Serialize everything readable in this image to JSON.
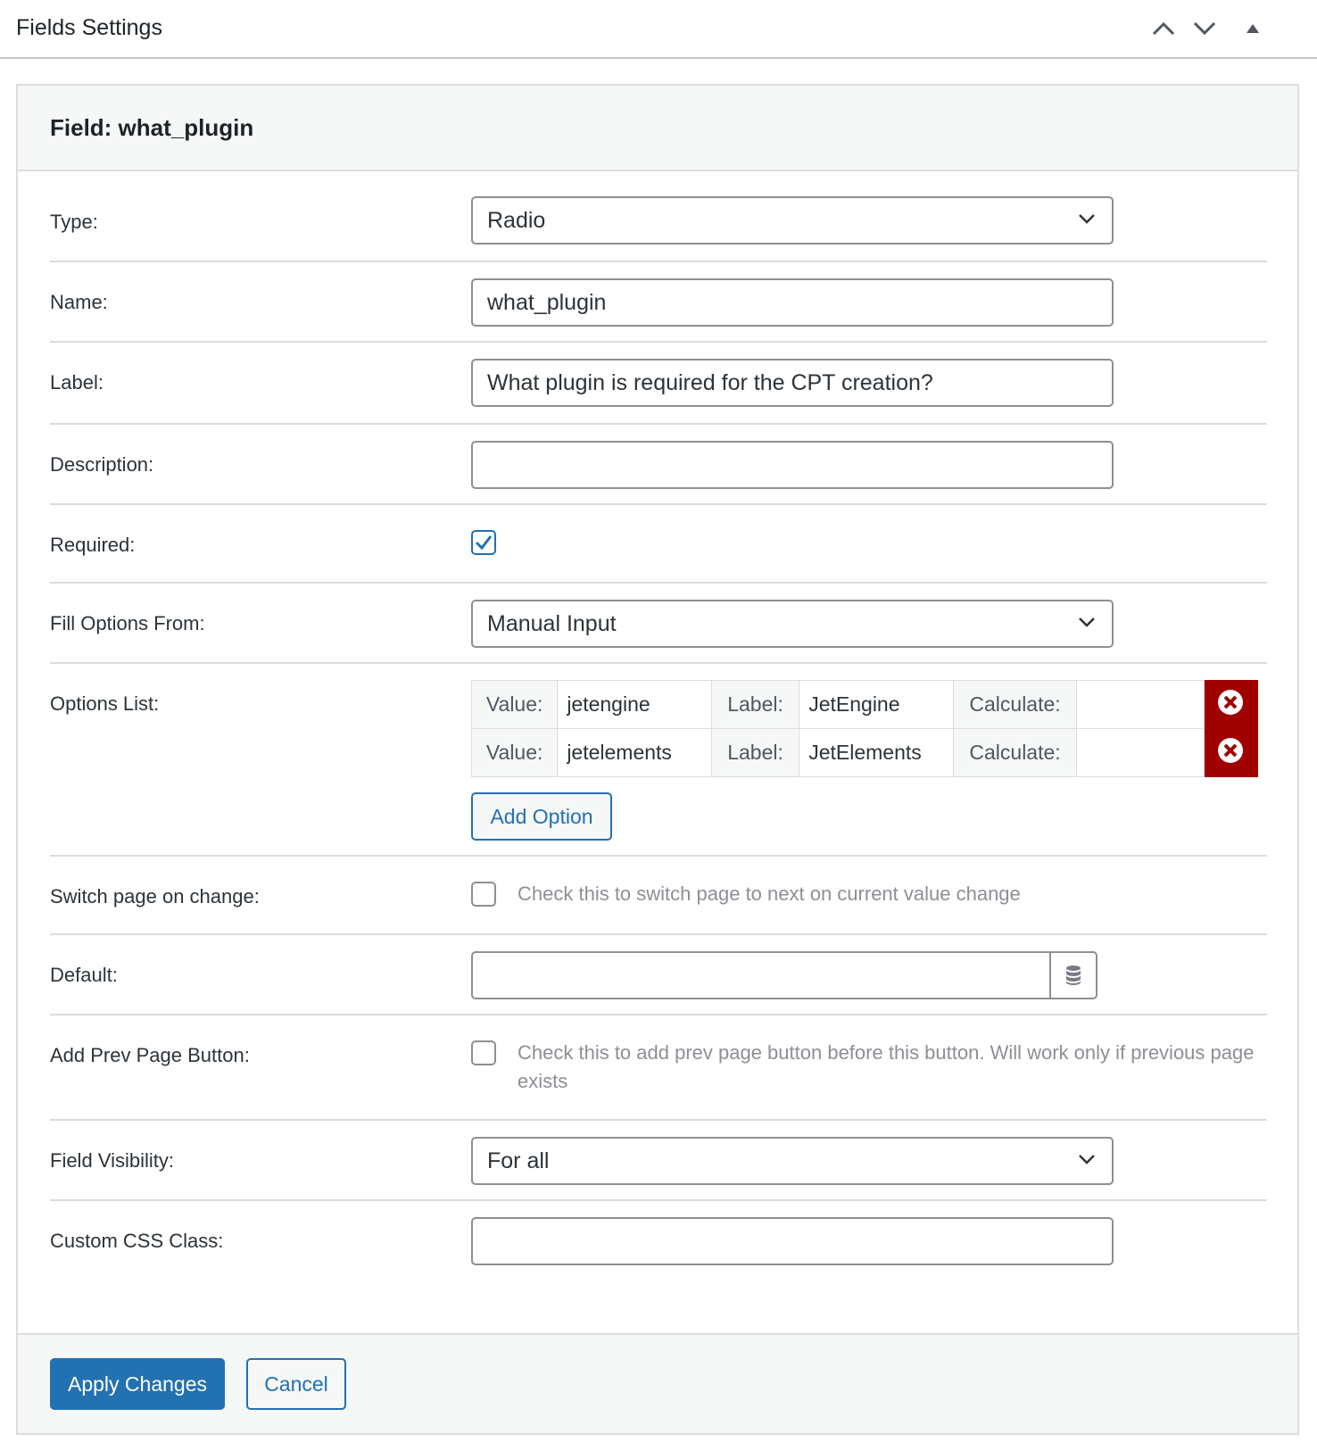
{
  "header": {
    "title": "Fields Settings",
    "icons": [
      "chevron-up-icon",
      "chevron-down-icon",
      "triangle-up-icon"
    ]
  },
  "panel": {
    "title": "Field: what_plugin"
  },
  "form": {
    "type": {
      "label": "Type:",
      "value": "Radio"
    },
    "name": {
      "label": "Name:",
      "value": "what_plugin"
    },
    "field_label": {
      "label": "Label:",
      "value": "What plugin is required for the CPT creation?"
    },
    "description": {
      "label": "Description:",
      "value": ""
    },
    "required": {
      "label": "Required:",
      "checked": true
    },
    "fill_options": {
      "label": "Fill Options From:",
      "value": "Manual Input"
    },
    "options_list": {
      "label": "Options List:",
      "value_label": "Value:",
      "label_label": "Label:",
      "calculate_label": "Calculate:",
      "rows": [
        {
          "value": "jetengine",
          "label": "JetEngine",
          "calculate": ""
        },
        {
          "value": "jetelements",
          "label": "JetElements",
          "calculate": ""
        }
      ],
      "add_option": "Add Option"
    },
    "switch_page": {
      "label": "Switch page on change:",
      "checked": false,
      "desc": "Check this to switch page to next on current value change"
    },
    "default": {
      "label": "Default:",
      "value": "",
      "icon": "database-icon"
    },
    "prev_page": {
      "label": "Add Prev Page Button:",
      "checked": false,
      "desc": "Check this to add prev page button before this button. Will work only if previous page exists"
    },
    "visibility": {
      "label": "Field Visibility:",
      "value": "For all"
    },
    "css_class": {
      "label": "Custom CSS Class:",
      "value": ""
    }
  },
  "footer": {
    "apply": "Apply Changes",
    "cancel": "Cancel"
  },
  "colors": {
    "primary": "#2271b1",
    "delete": "#a00000",
    "border": "#8c8f94"
  }
}
